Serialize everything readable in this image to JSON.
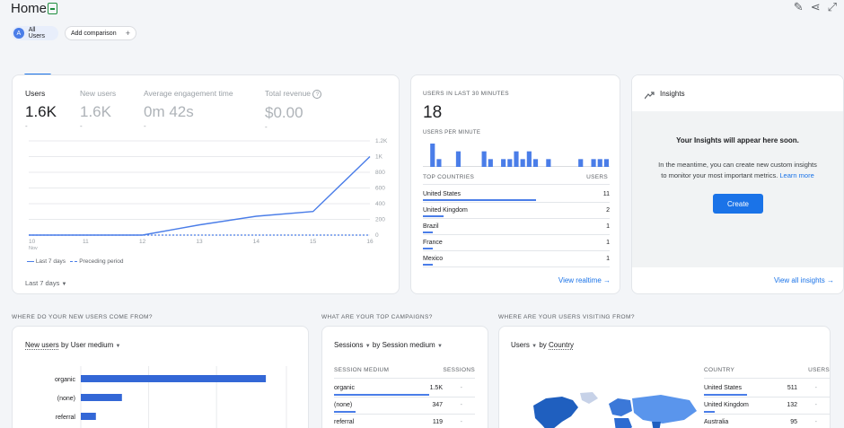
{
  "header": {
    "title": "Home",
    "icons": [
      "edit-icon",
      "share-icon",
      "expand-icon"
    ]
  },
  "chips": {
    "all_users": "All Users",
    "avatar": "A",
    "add_comparison": "Add comparison",
    "add_symbol": "+"
  },
  "overview": {
    "metrics": [
      {
        "label": "Users",
        "value": "1.6K",
        "sub": "-"
      },
      {
        "label": "New users",
        "value": "1.6K",
        "sub": "-"
      },
      {
        "label": "Average engagement time",
        "value": "0m 42s",
        "sub": "-"
      },
      {
        "label": "Total revenue",
        "value": "$0.00",
        "sub": "-",
        "help": "?"
      }
    ],
    "legend_current": "Last 7 days",
    "legend_previous": "Preceding period",
    "date_range": "Last 7 days",
    "chart_data": {
      "type": "line",
      "x": [
        "10",
        "11",
        "12",
        "13",
        "14",
        "15",
        "16"
      ],
      "x_sublabel": "Nov",
      "series": [
        {
          "name": "Last 7 days",
          "values": [
            0,
            0,
            0,
            130,
            240,
            300,
            1000
          ],
          "color": "#4a7de8"
        },
        {
          "name": "Preceding period",
          "values": [
            0,
            0,
            0,
            0,
            0,
            0,
            0
          ],
          "color": "#4a7de8"
        }
      ],
      "y_ticks": [
        "0",
        "200",
        "400",
        "600",
        "800",
        "1K",
        "1.2K"
      ],
      "ylim": [
        0,
        1200
      ]
    }
  },
  "realtime": {
    "heading": "USERS IN LAST 30 MINUTES",
    "value": "18",
    "per_minute_label": "USERS PER MINUTE",
    "chart_data": {
      "type": "bar",
      "values": [
        0,
        3,
        1,
        0,
        0,
        2,
        0,
        0,
        0,
        2,
        1,
        0,
        1,
        1,
        2,
        1,
        2,
        1,
        0,
        1,
        0,
        0,
        0,
        0,
        1,
        0,
        1,
        1,
        1
      ],
      "color": "#4a7de8"
    },
    "countries_header": "TOP COUNTRIES",
    "users_header": "USERS",
    "rows": [
      {
        "country": "United States",
        "users": "11",
        "share": 1.0
      },
      {
        "country": "United Kingdom",
        "users": "2",
        "share": 0.18
      },
      {
        "country": "Brazil",
        "users": "1",
        "share": 0.09
      },
      {
        "country": "France",
        "users": "1",
        "share": 0.09
      },
      {
        "country": "Mexico",
        "users": "1",
        "share": 0.09
      }
    ],
    "view_link": "View realtime",
    "arrow": "→"
  },
  "insights": {
    "title": "Insights",
    "headline": "Your Insights will appear here soon.",
    "body_line1": "In the meantime, you can create new custom insights",
    "body_line2": "to monitor your most important metrics.",
    "learn_more": "Learn more",
    "create": "Create",
    "view_all": "View all insights",
    "arrow": "→"
  },
  "acquisition": {
    "section": "WHERE DO YOUR NEW USERS COME FROM?",
    "dimension_metric": "New users",
    "dimension_word": "by",
    "dimension": "User medium",
    "chart_data": {
      "type": "bar",
      "categories": [
        "organic",
        "(none)",
        "referral"
      ],
      "values": [
        1350,
        300,
        110
      ],
      "xlim": [
        0,
        1500
      ],
      "color": "#3367d6"
    }
  },
  "campaigns": {
    "section": "WHAT ARE YOUR TOP CAMPAIGNS?",
    "metric": "Sessions",
    "dimension_word": "by",
    "dimension": "Session medium",
    "col1": "SESSION MEDIUM",
    "col2": "SESSIONS",
    "rows": [
      {
        "medium": "organic",
        "sessions": "1.5K",
        "change": "-",
        "share": 1.0
      },
      {
        "medium": "(none)",
        "sessions": "347",
        "change": "-",
        "share": 0.23
      },
      {
        "medium": "referral",
        "sessions": "119",
        "change": "-",
        "share": 0.08
      }
    ]
  },
  "geo": {
    "section": "WHERE ARE YOUR USERS VISITING FROM?",
    "metric": "Users",
    "dimension_word": "by",
    "dimension": "Country",
    "col1": "COUNTRY",
    "col2": "USERS",
    "rows": [
      {
        "country": "United States",
        "users": "511",
        "change": "-",
        "share": 1.0
      },
      {
        "country": "United Kingdom",
        "users": "132",
        "change": "-",
        "share": 0.26
      },
      {
        "country": "Australia",
        "users": "95",
        "change": "-",
        "share": 0.19
      }
    ]
  }
}
